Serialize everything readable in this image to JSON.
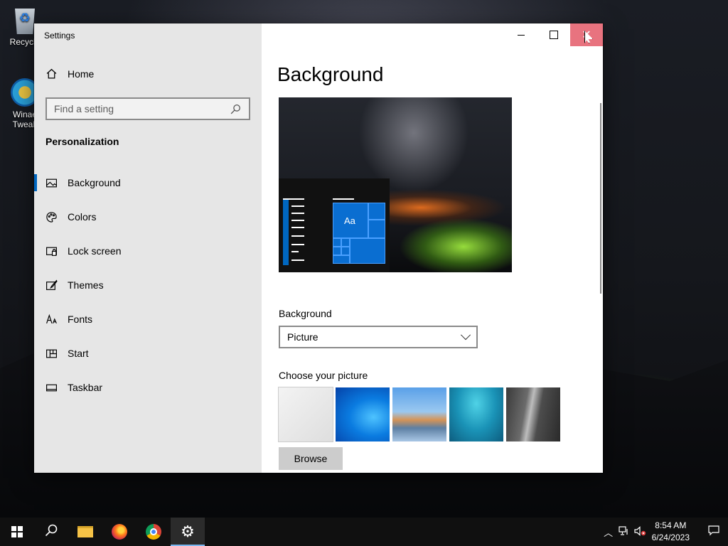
{
  "desktop": {
    "icons": [
      {
        "label": "Recycle",
        "icon": "recycle-bin-icon"
      },
      {
        "label": "Winae Tweak",
        "icon": "winaero-tweaker-icon"
      }
    ]
  },
  "window": {
    "title": "Settings",
    "controls": {
      "minimize": "minimize-icon",
      "maximize": "maximize-icon",
      "close": "close-icon"
    }
  },
  "sidebar": {
    "home_label": "Home",
    "search_placeholder": "Find a setting",
    "section_title": "Personalization",
    "items": [
      {
        "label": "Background",
        "icon": "picture-icon",
        "active": true
      },
      {
        "label": "Colors",
        "icon": "palette-icon",
        "active": false
      },
      {
        "label": "Lock screen",
        "icon": "lock-screen-icon",
        "active": false
      },
      {
        "label": "Themes",
        "icon": "brush-icon",
        "active": false
      },
      {
        "label": "Fonts",
        "icon": "fonts-icon",
        "active": false
      },
      {
        "label": "Start",
        "icon": "start-grid-icon",
        "active": false
      },
      {
        "label": "Taskbar",
        "icon": "taskbar-icon",
        "active": false
      }
    ]
  },
  "main": {
    "title": "Background",
    "preview_sample_text": "Aa",
    "background_label": "Background",
    "background_value": "Picture",
    "choose_label": "Choose your picture",
    "browse_label": "Browse"
  },
  "taskbar": {
    "apps": [
      "start-icon",
      "search-icon",
      "file-explorer-icon",
      "firefox-icon",
      "chrome-icon",
      "settings-icon"
    ],
    "active_app": "settings-icon",
    "time": "8:54 AM",
    "date": "6/24/2023",
    "tray_icons": [
      "chevron-up-icon",
      "network-icon",
      "volume-muted-icon",
      "notification-icon"
    ]
  },
  "colors": {
    "accent": "#0067c0",
    "close_hover": "#e8737f",
    "sidebar_bg": "#e6e6e6"
  }
}
